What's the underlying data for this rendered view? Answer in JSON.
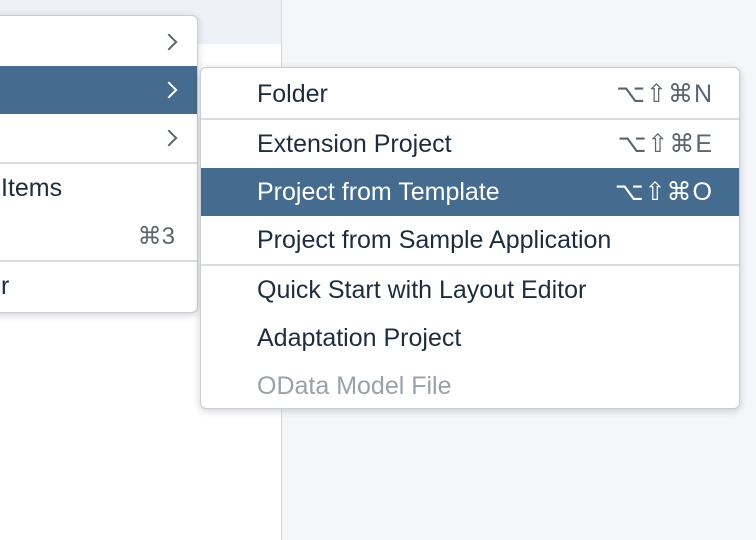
{
  "parent_menu": {
    "items": [
      {
        "label": "",
        "shortcut": "",
        "submenu": true
      },
      {
        "label": "",
        "shortcut": "",
        "submenu": true,
        "selected": true
      },
      {
        "label": "",
        "shortcut": "",
        "submenu": true
      },
      {
        "label": "Items",
        "shortcut": ""
      },
      {
        "label": "",
        "shortcut": "⌘3"
      },
      {
        "label": "r",
        "shortcut": ""
      }
    ]
  },
  "sub_menu": {
    "items": [
      {
        "label": "Folder",
        "shortcut": "⌥⇧⌘N"
      },
      {
        "label": "Extension Project",
        "shortcut": "⌥⇧⌘E"
      },
      {
        "label": "Project from Template",
        "shortcut": "⌥⇧⌘O",
        "selected": true
      },
      {
        "label": "Project from Sample Application",
        "shortcut": ""
      },
      {
        "label": "Quick Start with Layout Editor",
        "shortcut": ""
      },
      {
        "label": "Adaptation Project",
        "shortcut": ""
      },
      {
        "label": "OData Model File",
        "shortcut": "",
        "disabled": true
      }
    ]
  },
  "colors": {
    "selection": "#456b8f",
    "text": "#1d2d3e",
    "disabled_text": "#9aa1a8"
  }
}
